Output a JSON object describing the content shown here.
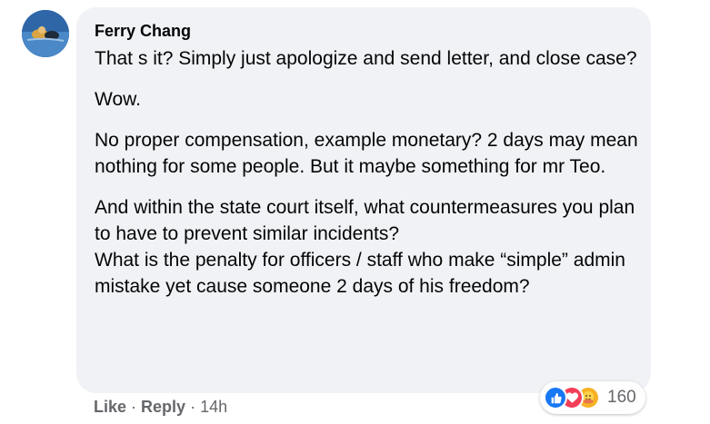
{
  "comment": {
    "author": "Ferry Chang",
    "paragraphs": [
      "That s it? Simply just apologize and send letter, and close case?",
      "Wow.",
      "No proper compensation, example monetary? 2 days may mean nothing for some people. But it maybe something for mr Teo.",
      "And within the state court itself, what countermeasures you plan to have to prevent similar incidents?\nWhat is the penalty for officers / staff who make “simple” admin mistake yet cause someone 2 days of his freedom?"
    ],
    "reactions": {
      "icons": [
        "like-icon",
        "love-icon",
        "care-icon"
      ],
      "count": "160"
    },
    "actions": {
      "like_label": "Like",
      "separator": "·",
      "reply_label": "Reply",
      "timestamp": "14h"
    }
  },
  "colors": {
    "bubble": "#f0f2f5",
    "text": "#050505",
    "secondary": "#65676b",
    "like_blue": "#1877f2",
    "love_red": "#f33e58",
    "care_yellow": "#f7b125"
  }
}
